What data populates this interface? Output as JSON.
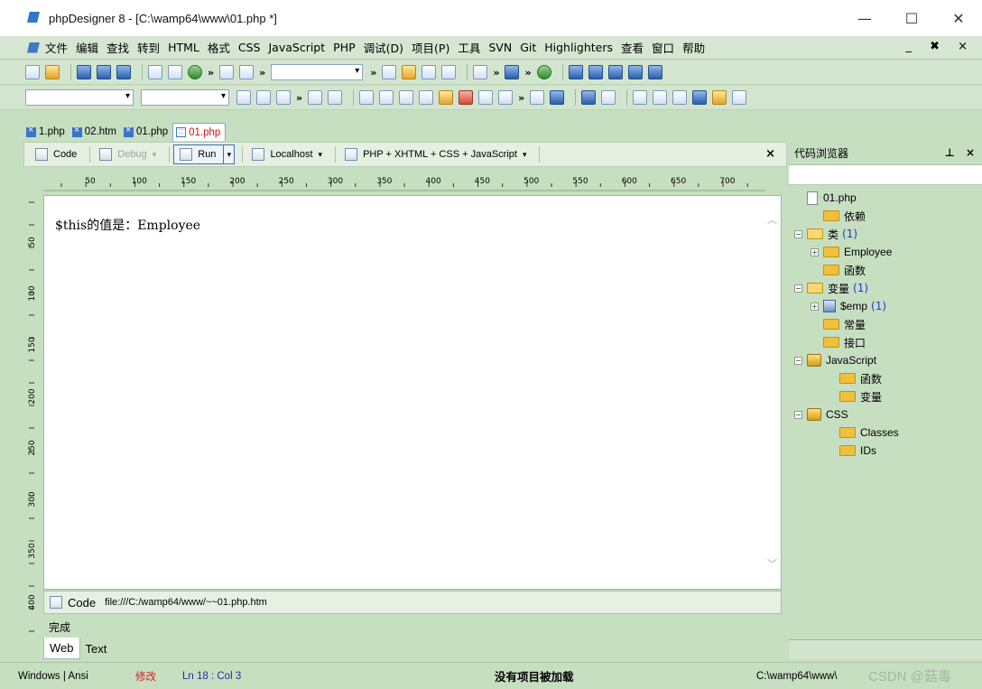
{
  "window": {
    "title": "phpDesigner 8 - [C:\\wamp64\\www\\01.php *]",
    "minimize": "—",
    "maximize": "☐",
    "close": "✕"
  },
  "menu": {
    "items": [
      "文件",
      "编辑",
      "查找",
      "转到",
      "HTML",
      "格式",
      "CSS",
      "JavaScript",
      "PHP",
      "调试(D)",
      "项目(P)",
      "工具",
      "SVN",
      "Git",
      "Highlighters",
      "查看",
      "窗口",
      "帮助"
    ],
    "mdi_controls": "_ ✖ ×"
  },
  "doc_tabs": [
    {
      "label": "1.php",
      "active": false
    },
    {
      "label": "02.htm",
      "active": false
    },
    {
      "label": "01.php",
      "active": false
    },
    {
      "label": "01.php",
      "active": true
    }
  ],
  "editor_toolbar": {
    "code": "Code",
    "debug": "Debug",
    "run": "Run",
    "localhost": "Localhost",
    "doctype": "PHP + XHTML + CSS + JavaScript",
    "close": "×"
  },
  "ruler": {
    "labels": [
      "50",
      "100",
      "150",
      "200",
      "250",
      "300",
      "350",
      "400",
      "450",
      "500",
      "550",
      "600",
      "650",
      "700"
    ],
    "vlabels": [
      "50",
      "100",
      "150",
      "200",
      "250",
      "300",
      "350",
      "400"
    ]
  },
  "editor": {
    "content": "$this的值是：Employee"
  },
  "preview_status": {
    "code_label": "Code",
    "path": "file:///C:/wamp64/www/~~01.php.htm",
    "done": "完成"
  },
  "bottom_tabs": [
    {
      "label": "Web",
      "active": true
    },
    {
      "label": "Text",
      "active": false
    }
  ],
  "code_browser": {
    "title": "代码浏览器",
    "controls": "⊥ ×",
    "tree": [
      {
        "label": "01.php",
        "icon": "file-icon",
        "level": 0,
        "expander": ""
      },
      {
        "label": "依赖",
        "icon": "folder-icon",
        "level": 1,
        "expander": ""
      },
      {
        "label": "类",
        "icon": "folder-open-icon",
        "level": 0,
        "expander": "−",
        "count": "(1)"
      },
      {
        "label": "Employee",
        "icon": "class-folder-icon",
        "level": 1,
        "expander": "+"
      },
      {
        "label": "函数",
        "icon": "folder-icon",
        "level": 1,
        "expander": ""
      },
      {
        "label": "变量",
        "icon": "folder-open-icon",
        "level": 0,
        "expander": "−",
        "count": "(1)"
      },
      {
        "label": "$emp",
        "icon": "variable-icon",
        "level": 1,
        "expander": "+",
        "count": "(1)"
      },
      {
        "label": "常量",
        "icon": "folder-icon",
        "level": 1,
        "expander": ""
      },
      {
        "label": "接口",
        "icon": "folder-icon",
        "level": 1,
        "expander": ""
      },
      {
        "label": "JavaScript",
        "icon": "javascript-icon",
        "level": 0,
        "expander": "−"
      },
      {
        "label": "函数",
        "icon": "folder-icon",
        "level": 2,
        "expander": ""
      },
      {
        "label": "变量",
        "icon": "folder-icon",
        "level": 2,
        "expander": ""
      },
      {
        "label": "CSS",
        "icon": "css-icon",
        "level": 0,
        "expander": "−"
      },
      {
        "label": "Classes",
        "icon": "folder-icon",
        "level": 2,
        "expander": ""
      },
      {
        "label": "IDs",
        "icon": "folder-icon",
        "level": 2,
        "expander": ""
      }
    ]
  },
  "statusbar": {
    "encoding": "Windows | Ansi",
    "modified": "修改",
    "position": "Ln   18 : Col  3",
    "project": "没有项目被加载",
    "path": "C:\\wamp64\\www\\",
    "watermark": "CSDN @菇毒"
  },
  "colors": {
    "chrome": "#c7dfc1",
    "active_tab_text": "#d01010",
    "status_modified": "#d62020",
    "tree_count": "#1a3ccc"
  }
}
